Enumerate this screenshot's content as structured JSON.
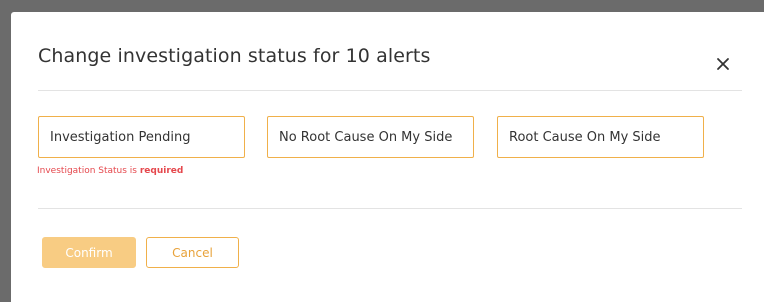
{
  "dialog": {
    "title": "Change investigation status for 10 alerts",
    "close_icon": "close-icon"
  },
  "status_options": [
    {
      "label": "Investigation Pending"
    },
    {
      "label": "No Root Cause On My Side"
    },
    {
      "label": "Root Cause On My Side"
    }
  ],
  "validation": {
    "message_prefix": "Investigation Status is ",
    "message_emphasis": "required"
  },
  "actions": {
    "confirm_label": "Confirm",
    "cancel_label": "Cancel"
  },
  "colors": {
    "accent": "#f0b04a",
    "confirm_disabled": "#f8cc83",
    "error": "#e5484d",
    "backdrop": "#6b6b6b"
  }
}
